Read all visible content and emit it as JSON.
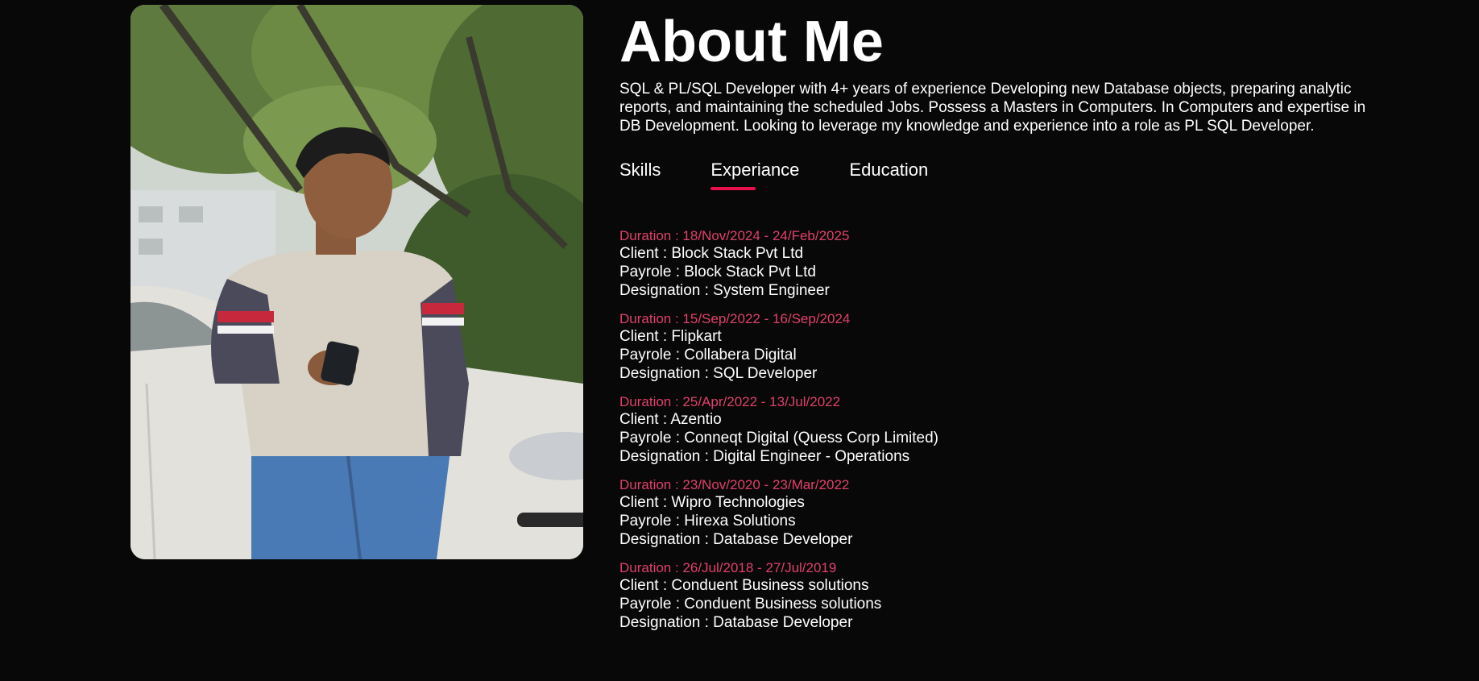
{
  "about": {
    "title": "About Me",
    "description": "SQL & PL/SQL Developer with 4+ years of experience Developing new Database objects, preparing analytic reports, and maintaining the scheduled Jobs. Possess a Masters in Computers. In Computers and expertise in DB Development. Looking to leverage my knowledge and experience into a role as PL SQL Developer."
  },
  "tabs": [
    {
      "label": "Skills",
      "active": false
    },
    {
      "label": "Experiance",
      "active": true
    },
    {
      "label": "Education",
      "active": false
    }
  ],
  "experience": [
    {
      "duration": "Duration : 18/Nov/2024 - 24/Feb/2025",
      "client": "Client : Block Stack Pvt Ltd",
      "payrole": "Payrole : Block Stack Pvt Ltd",
      "designation": "Designation : System Engineer"
    },
    {
      "duration": "Duration : 15/Sep/2022 - 16/Sep/2024",
      "client": "Client : Flipkart",
      "payrole": "Payrole : Collabera Digital",
      "designation": "Designation : SQL Developer"
    },
    {
      "duration": "Duration : 25/Apr/2022 - 13/Jul/2022",
      "client": "Client : Azentio",
      "payrole": "Payrole : Conneqt Digital (Quess Corp Limited)",
      "designation": "Designation : Digital Engineer - Operations"
    },
    {
      "duration": "Duration : 23/Nov/2020 - 23/Mar/2022",
      "client": "Client : Wipro Technologies",
      "payrole": "Payrole : Hirexa Solutions",
      "designation": "Designation : Database Developer"
    },
    {
      "duration": "Duration : 26/Jul/2018 - 27/Jul/2019",
      "client": "Client : Conduent Business solutions",
      "payrole": "Payrole : Conduent Business solutions",
      "designation": "Designation : Database Developer"
    }
  ],
  "colors": {
    "background": "#080808",
    "accent": "#e8104c",
    "duration_text": "#e0406a"
  }
}
